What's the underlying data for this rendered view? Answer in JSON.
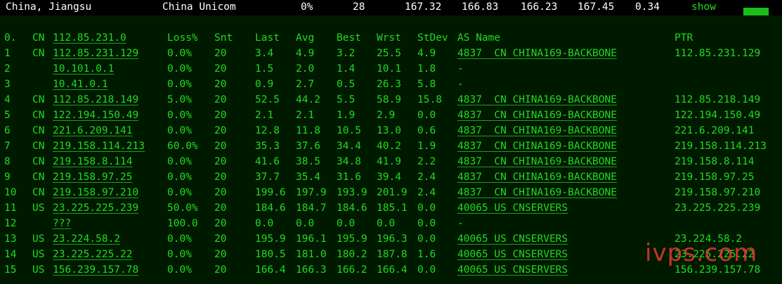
{
  "summary": {
    "location": "China, Jiangsu",
    "isp": "China Unicom",
    "loss": "0%",
    "sent": "28",
    "last": "167.32",
    "avg": "166.83",
    "best": "166.23",
    "wrst": "167.45",
    "stdev": "0.34",
    "show_label": "show"
  },
  "header": {
    "idx": "0.",
    "cc": "CN",
    "host": "112.85.231.0",
    "loss": "Loss%",
    "snt": "Snt",
    "last": "Last",
    "avg": "Avg",
    "best": "Best",
    "wrst": "Wrst",
    "stdev": "StDev",
    "as_name": "AS Name",
    "ptr": "PTR"
  },
  "rows": [
    {
      "idx": "1",
      "cc": "CN",
      "host": "112.85.231.129",
      "loss": "0.0%",
      "snt": "20",
      "last": "3.4",
      "avg": "4.9",
      "best": "3.2",
      "wrst": "25.5",
      "stdev": "4.9",
      "as": "4837  CN CHINA169-BACKBONE",
      "ptr": "112.85.231.129"
    },
    {
      "idx": "2",
      "cc": "",
      "host": "10.101.0.1",
      "loss": "0.0%",
      "snt": "20",
      "last": "1.5",
      "avg": "2.0",
      "best": "1.4",
      "wrst": "10.1",
      "stdev": "1.8",
      "as": "-",
      "ptr": ""
    },
    {
      "idx": "3",
      "cc": "",
      "host": "10.41.0.1",
      "loss": "0.0%",
      "snt": "20",
      "last": "0.9",
      "avg": "2.7",
      "best": "0.5",
      "wrst": "26.3",
      "stdev": "5.8",
      "as": "-",
      "ptr": ""
    },
    {
      "idx": "4",
      "cc": "CN",
      "host": "112.85.218.149",
      "loss": "5.0%",
      "snt": "20",
      "last": "52.5",
      "avg": "44.2",
      "best": "5.5",
      "wrst": "58.9",
      "stdev": "15.8",
      "as": "4837  CN CHINA169-BACKBONE",
      "ptr": "112.85.218.149"
    },
    {
      "idx": "5",
      "cc": "CN",
      "host": "122.194.150.49",
      "loss": "0.0%",
      "snt": "20",
      "last": "2.1",
      "avg": "2.1",
      "best": "1.9",
      "wrst": "2.9",
      "stdev": "0.0",
      "as": "4837  CN CHINA169-BACKBONE",
      "ptr": "122.194.150.49"
    },
    {
      "idx": "6",
      "cc": "CN",
      "host": "221.6.209.141",
      "loss": "0.0%",
      "snt": "20",
      "last": "12.8",
      "avg": "11.8",
      "best": "10.5",
      "wrst": "13.0",
      "stdev": "0.6",
      "as": "4837  CN CHINA169-BACKBONE",
      "ptr": "221.6.209.141"
    },
    {
      "idx": "7",
      "cc": "CN",
      "host": "219.158.114.213",
      "loss": "60.0%",
      "snt": "20",
      "last": "35.3",
      "avg": "37.6",
      "best": "34.4",
      "wrst": "40.2",
      "stdev": "1.9",
      "as": "4837  CN CHINA169-BACKBONE",
      "ptr": "219.158.114.213"
    },
    {
      "idx": "8",
      "cc": "CN",
      "host": "219.158.8.114",
      "loss": "0.0%",
      "snt": "20",
      "last": "41.6",
      "avg": "38.5",
      "best": "34.8",
      "wrst": "41.9",
      "stdev": "2.2",
      "as": "4837  CN CHINA169-BACKBONE",
      "ptr": "219.158.8.114"
    },
    {
      "idx": "9",
      "cc": "CN",
      "host": "219.158.97.25",
      "loss": "0.0%",
      "snt": "20",
      "last": "37.7",
      "avg": "35.4",
      "best": "31.6",
      "wrst": "39.4",
      "stdev": "2.4",
      "as": "4837  CN CHINA169-BACKBONE",
      "ptr": "219.158.97.25"
    },
    {
      "idx": "10",
      "cc": "CN",
      "host": "219.158.97.210",
      "loss": "0.0%",
      "snt": "20",
      "last": "199.6",
      "avg": "197.9",
      "best": "193.9",
      "wrst": "201.9",
      "stdev": "2.4",
      "as": "4837  CN CHINA169-BACKBONE",
      "ptr": "219.158.97.210"
    },
    {
      "idx": "11",
      "cc": "US",
      "host": "23.225.225.239",
      "loss": "50.0%",
      "snt": "20",
      "last": "184.6",
      "avg": "184.7",
      "best": "184.6",
      "wrst": "185.1",
      "stdev": "0.0",
      "as": "40065 US CNSERVERS",
      "ptr": "23.225.225.239"
    },
    {
      "idx": "12",
      "cc": "",
      "host": "???",
      "loss": "100.0",
      "snt": "20",
      "last": "0.0",
      "avg": "0.0",
      "best": "0.0",
      "wrst": "0.0",
      "stdev": "0.0",
      "as": "-",
      "ptr": ""
    },
    {
      "idx": "13",
      "cc": "US",
      "host": "23.224.58.2",
      "loss": "0.0%",
      "snt": "20",
      "last": "195.9",
      "avg": "196.1",
      "best": "195.9",
      "wrst": "196.3",
      "stdev": "0.0",
      "as": "40065 US CNSERVERS",
      "ptr": "23.224.58.2"
    },
    {
      "idx": "14",
      "cc": "US",
      "host": "23.225.225.22",
      "loss": "0.0%",
      "snt": "20",
      "last": "180.5",
      "avg": "181.0",
      "best": "180.2",
      "wrst": "187.8",
      "stdev": "1.6",
      "as": "40065 US CNSERVERS",
      "ptr": "23.225.225.22"
    },
    {
      "idx": "15",
      "cc": "US",
      "host": "156.239.157.78",
      "loss": "0.0%",
      "snt": "20",
      "last": "166.4",
      "avg": "166.3",
      "best": "166.2",
      "wrst": "166.4",
      "stdev": "0.0",
      "as": "40065 US CNSERVERS",
      "ptr": "156.239.157.78"
    }
  ],
  "watermark": "ivps.com",
  "colors": {
    "text_green": "#22d822",
    "background": "#001a00",
    "summary_text": "#ffffff",
    "watermark": "#e53935"
  }
}
